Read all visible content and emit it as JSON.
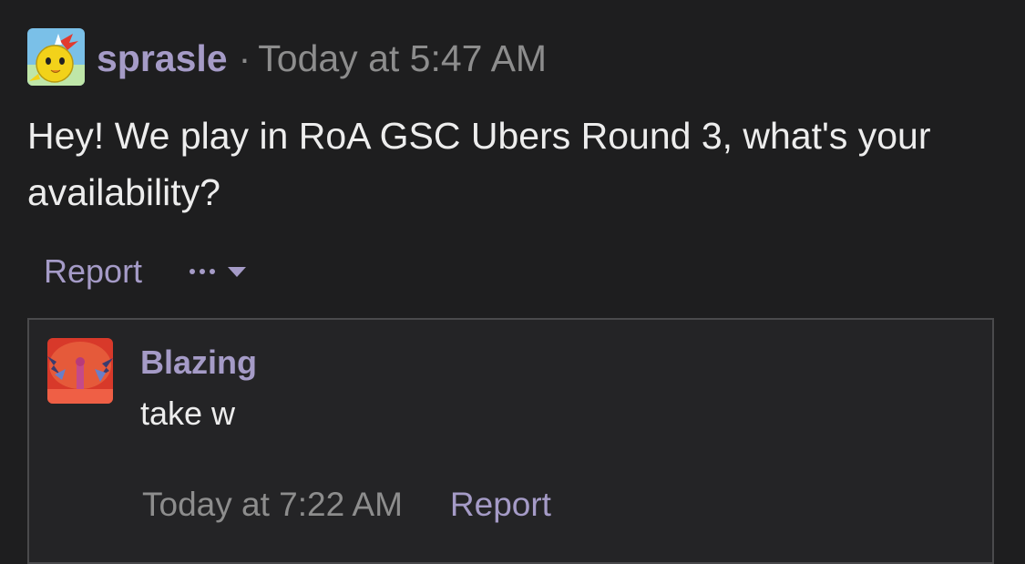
{
  "post": {
    "author": "sprasle",
    "separator": "·",
    "timestamp": "Today at 5:47 AM",
    "message": "Hey! We play in RoA GSC Ubers Round 3, what's your availability?",
    "avatar_icon": "yellow-chick-avatar",
    "actions": {
      "report_label": "Report",
      "more_icon": "ellipsis-icon",
      "caret_icon": "caret-down-icon"
    }
  },
  "reply": {
    "author": "Blazing",
    "message": "take w",
    "timestamp": "Today at 7:22 AM",
    "report_label": "Report",
    "avatar_icon": "red-scene-avatar"
  },
  "colors": {
    "background": "#1e1e1f",
    "accent": "#a59bc7",
    "text": "#ededed",
    "muted": "#8d8d8d",
    "reply_border": "#4a4a4c",
    "reply_background": "#242426"
  }
}
